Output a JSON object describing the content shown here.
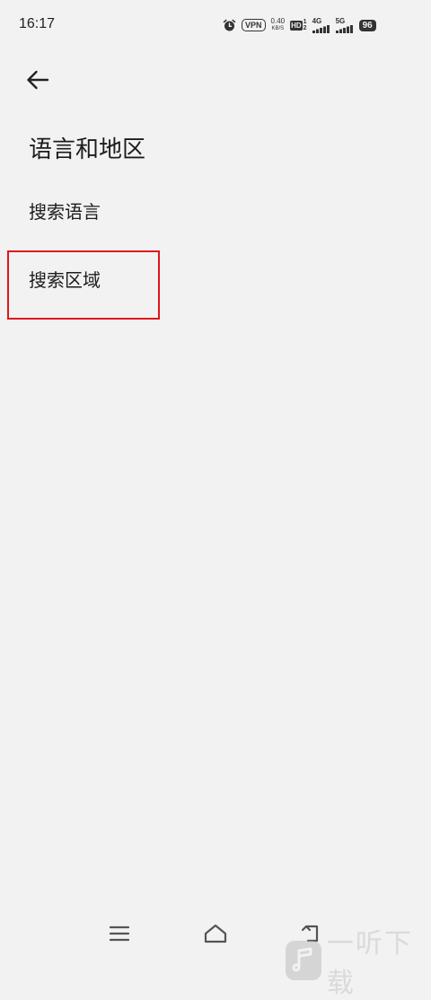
{
  "status_bar": {
    "time": "16:17",
    "vpn": "VPN",
    "speed_value": "0.40",
    "speed_unit": "KB/S",
    "hd_label": "HD",
    "hd_sim_top": "1",
    "hd_sim_bottom": "2",
    "sim1_network": "4G",
    "sim2_network": "5G",
    "battery": "96",
    "icons": [
      "alarm-icon",
      "vpn-icon",
      "network-speed",
      "hd-icon",
      "signal-4g-icon",
      "signal-5g-icon",
      "battery-icon"
    ]
  },
  "header": {
    "back_icon": "arrow-left-icon",
    "title": "语言和地区"
  },
  "menu": {
    "items": [
      {
        "label": "搜索语言"
      },
      {
        "label": "搜索区域"
      }
    ]
  },
  "annotation": {
    "highlight_color": "#e0161b"
  },
  "nav_bar": {
    "icons": [
      "menu-icon",
      "home-icon",
      "back-icon"
    ]
  },
  "watermark": {
    "text": "一听下载"
  }
}
